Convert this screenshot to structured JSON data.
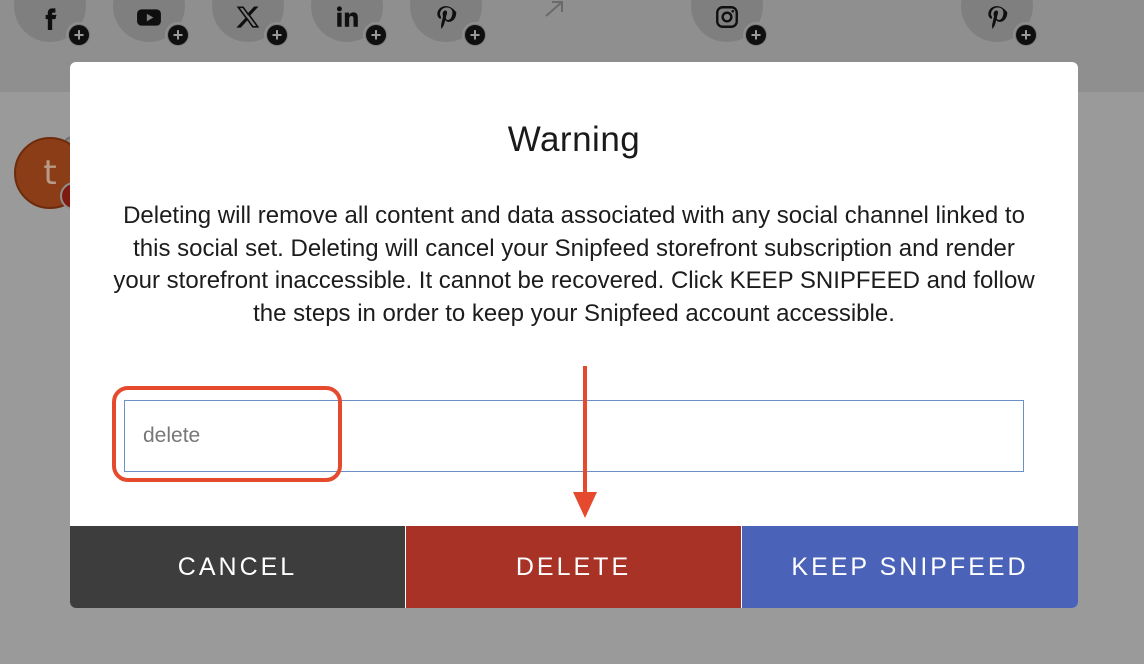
{
  "background": {
    "social_icons": [
      {
        "name": "facebook-icon",
        "glyph": "f"
      },
      {
        "name": "youtube-icon",
        "glyph": "▶"
      },
      {
        "name": "x-twitter-icon",
        "glyph": "𝕏"
      },
      {
        "name": "linkedin-icon",
        "glyph": "in"
      },
      {
        "name": "pinterest-icon",
        "glyph": "p"
      },
      {
        "name": "instagram-icon",
        "glyph": "◎"
      },
      {
        "name": "pinterest-icon",
        "glyph": "p"
      }
    ],
    "avatar_letter": "t"
  },
  "modal": {
    "title": "Warning",
    "body": "Deleting will remove all content and data associated with any social channel linked to this social set. Deleting will cancel your Snipfeed storefront subscription and render your storefront inaccessible. It cannot be recovered. Click KEEP SNIPFEED and follow the steps in order to keep your Snipfeed account accessible.",
    "input": {
      "placeholder": "delete",
      "value": ""
    },
    "buttons": {
      "cancel": "CANCEL",
      "delete": "DELETE",
      "keep": "KEEP SNIPFEED"
    }
  },
  "colors": {
    "cancel_bg": "#3d3d3d",
    "delete_bg": "#a83226",
    "keep_bg": "#4a63b8",
    "annotation": "#e54a2e"
  }
}
